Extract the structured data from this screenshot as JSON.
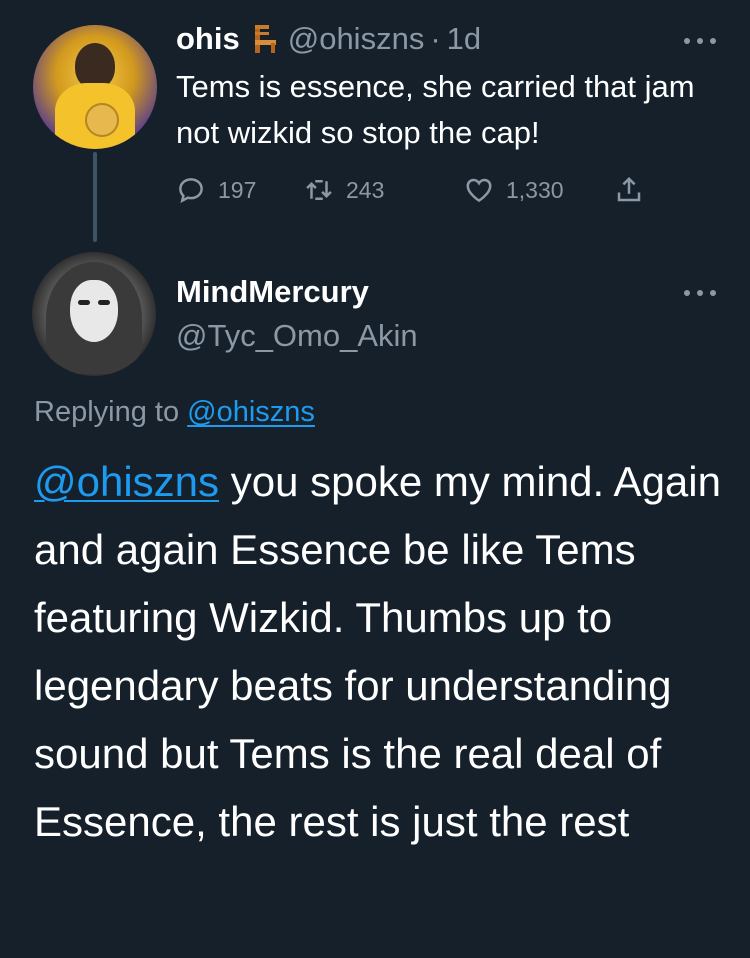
{
  "parent_tweet": {
    "display_name": "ohis",
    "handle": "@ohiszns",
    "separator": "·",
    "time": "1d",
    "text": "Tems is essence, she carried that jam not wizkid so stop the cap!",
    "stats": {
      "replies": "197",
      "retweets": "243",
      "likes": "1,330"
    },
    "name_emoji": "chair-icon"
  },
  "reply_tweet": {
    "display_name": "MindMercury",
    "handle": "@Tyc_Omo_Akin",
    "replying_prefix": "Replying to ",
    "replying_to": "@ohiszns",
    "mention": "@ohiszns",
    "text": " you spoke my mind. Again and again Essence be like Tems featuring Wizkid. Thumbs up to legendary beats for understanding sound but Tems is the real deal of Essence, the rest is just the rest"
  },
  "colors": {
    "background": "#15202b",
    "primary_text": "#ffffff",
    "secondary_text": "#8b98a5",
    "link": "#1d9bf0"
  }
}
